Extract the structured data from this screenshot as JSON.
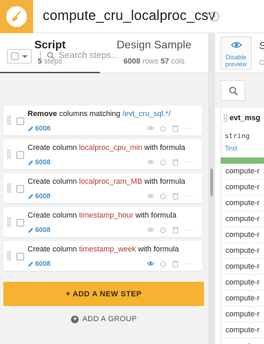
{
  "header": {
    "title": "compute_cru_localproc_csv"
  },
  "tabs": {
    "script": {
      "label": "Script",
      "count": "5",
      "count_unit": "steps"
    },
    "design": {
      "label": "Design Sample",
      "rows": "6008",
      "rows_unit": "rows",
      "cols": "57",
      "cols_unit": "cols"
    }
  },
  "search": {
    "placeholder": "Search steps..."
  },
  "steps": [
    {
      "parts": [
        "Remove",
        " columns matching ",
        "/evt_cru_sql.*/"
      ],
      "count": "6008",
      "preview_enabled": false
    },
    {
      "parts": [
        "Create column ",
        "localproc_cpu_min",
        " with formula"
      ],
      "count": "6008",
      "preview_enabled": false
    },
    {
      "parts": [
        "Create column ",
        "localproc_ram_MB",
        " with formula"
      ],
      "count": "6008",
      "preview_enabled": false
    },
    {
      "parts": [
        "Create column ",
        "timestamp_hour",
        " with formula"
      ],
      "count": "6008",
      "preview_enabled": false
    },
    {
      "parts": [
        "Create column ",
        "timestamp_week",
        " with formula"
      ],
      "count": "6008",
      "preview_enabled": true
    }
  ],
  "actions": {
    "add_step": "+ ADD A NEW STEP",
    "add_group": "ADD A GROUP"
  },
  "right_panel": {
    "disable_preview_line1": "Disable",
    "disable_preview_line2": "preview",
    "truncated_title": "S",
    "truncated_sub": "C",
    "column": {
      "name": "evt_msg",
      "type": "string",
      "meaning": "Text"
    },
    "cells": [
      "compute-r",
      "compute-r",
      "compute-r",
      "compute-r",
      "compute-r",
      "compute-r",
      "compute-r",
      "compute-r",
      "compute-r",
      "compute-r",
      "compute-r",
      "compute-r"
    ]
  },
  "colors": {
    "accent": "#f7b232",
    "logo": "#f4b13b",
    "link": "#3d8fd1",
    "column_name": "#b53a28",
    "valid_bar": "#7ebd73"
  }
}
